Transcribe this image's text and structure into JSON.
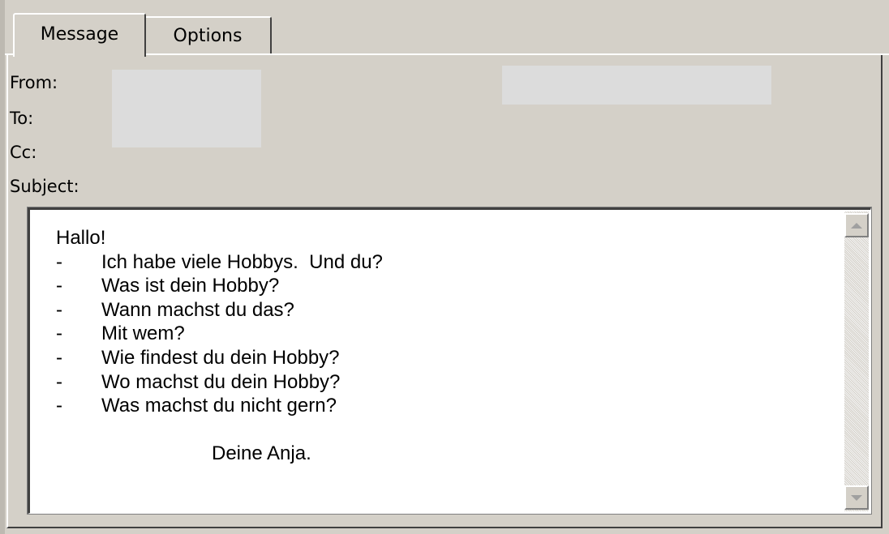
{
  "tabs": {
    "message_label": "Message",
    "options_label": "Options"
  },
  "header_fields": {
    "from_label": "From:",
    "to_label": "To:",
    "cc_label": "Cc:",
    "subject_label": "Subject:"
  },
  "message": {
    "greeting": "Hallo!",
    "bullet_marker": "-",
    "items": [
      "Ich habe viele Hobbys.  Und du?",
      "Was ist dein Hobby?",
      "Wann machst du das?",
      "Mit wem?",
      "Wie findest du dein Hobby?",
      "Wo machst du dein Hobby?",
      "Was machst du nicht gern?"
    ],
    "signature": "Deine Anja."
  },
  "icons": {
    "scroll_up": "scroll-up-arrow-icon",
    "scroll_down": "scroll-down-arrow-icon"
  },
  "colors": {
    "window_face": "#d4d0c8",
    "body_background": "#ffffff",
    "redaction": "#dcdcdc"
  }
}
